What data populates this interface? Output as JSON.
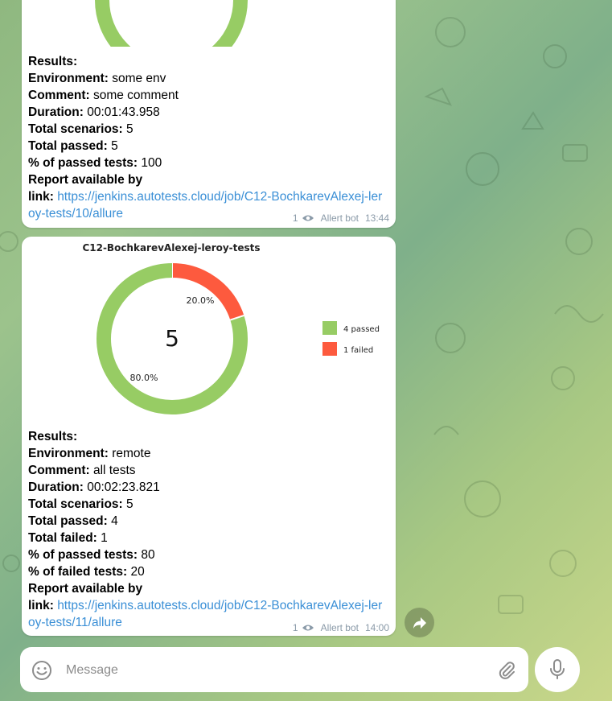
{
  "messages": [
    {
      "text_lines": [
        {
          "label": "Results:",
          "value": ""
        },
        {
          "label": "Environment:",
          "value": " some env"
        },
        {
          "label": "Comment:",
          "value": " some comment"
        },
        {
          "label": "Duration:",
          "value": " 00:01:43.958"
        },
        {
          "label": "Total scenarios:",
          "value": " 5"
        },
        {
          "label": "Total passed:",
          "value": " 5"
        },
        {
          "label": "% of passed tests:",
          "value": " 100"
        }
      ],
      "report_label_1": "Report available by",
      "report_label_2": "link:",
      "link": "https://jenkins.autotests.cloud/job/C12-BochkarevAlexej-leroy-tests/10/allure",
      "views": "1",
      "author": "Allert bot",
      "time": "13:44"
    },
    {
      "chart_data": {
        "type": "pie",
        "title": "C12-BochkarevAlexej-leroy-tests",
        "center_label": "5",
        "slices": [
          {
            "label": "4 passed",
            "value": 4,
            "percent": "80.0%",
            "color": "#97cc64"
          },
          {
            "label": "1 failed",
            "value": 1,
            "percent": "20.0%",
            "color": "#fd5a3e"
          }
        ]
      },
      "text_lines": [
        {
          "label": "Results:",
          "value": ""
        },
        {
          "label": "Environment:",
          "value": " remote"
        },
        {
          "label": "Comment:",
          "value": " all tests"
        },
        {
          "label": "Duration:",
          "value": " 00:02:23.821"
        },
        {
          "label": "Total scenarios:",
          "value": " 5"
        },
        {
          "label": "Total passed:",
          "value": " 4"
        },
        {
          "label": "Total failed:",
          "value": " 1"
        },
        {
          "label": "% of passed tests:",
          "value": " 80"
        },
        {
          "label": "% of failed tests:",
          "value": " 20"
        }
      ],
      "report_label_1": "Report available by",
      "report_label_2": "link:",
      "link": "https://jenkins.autotests.cloud/job/C12-BochkarevAlexej-leroy-tests/11/allure",
      "views": "1",
      "author": "Allert bot",
      "time": "14:00"
    }
  ],
  "composer": {
    "placeholder": "Message"
  },
  "icons": {
    "emoji": "smile-icon",
    "attach": "paperclip-icon",
    "mic": "microphone-icon",
    "share": "share-arrow-icon",
    "views": "eye-icon"
  },
  "colors": {
    "link": "#3a8fd6",
    "passed": "#97cc64",
    "failed": "#fd5a3e"
  }
}
